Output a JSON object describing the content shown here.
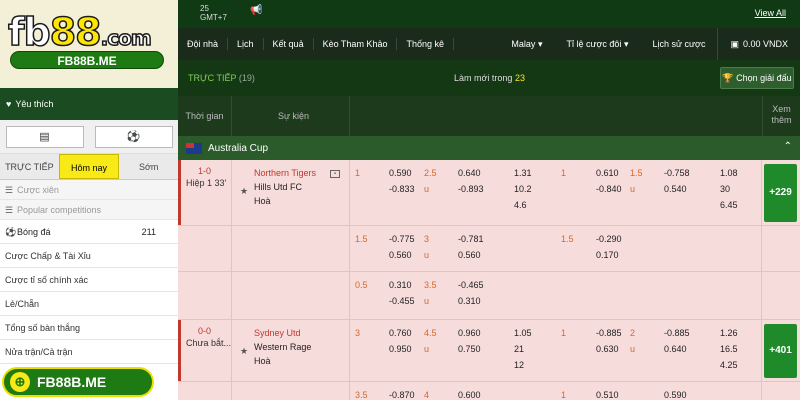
{
  "topbar": {
    "gmt_line1": "25",
    "gmt_line2": "GMT+7",
    "view_all": "View All"
  },
  "logo": {
    "brand_a": "fb",
    "brand_b": "88",
    "brand_c": ".com",
    "subtitle": "FB88B.ME"
  },
  "nav": {
    "items": [
      "Đội nhà",
      "Lịch",
      "Kết quả",
      "Kèo Tham Khảo",
      "Thống kê"
    ],
    "odds_type": "Malay",
    "odds_ratio": "Tỉ lệ cược đôi",
    "history": "Lịch sử cược",
    "balance": "0.00 VNDX"
  },
  "sidebar": {
    "favorites": "Yêu thích",
    "tabs": [
      "TRỰC TIẾP",
      "Hôm nay",
      "Sớm"
    ],
    "bet_type": "Cược xiên",
    "popular": "Popular competitions",
    "sport": "Bóng đá",
    "sport_count": "211",
    "menu": [
      "Cược Chấp & Tài Xỉu",
      "Cược tỉ số chính xác",
      "Lẻ/Chẵn",
      "Tổng số bàn thắng",
      "Nửa trận/Cả trận"
    ],
    "bottom_badge": "FB88B.ME"
  },
  "main": {
    "live_label": "TRỰC TIẾP",
    "live_count": "(19)",
    "refresh_label": "Làm mới trong",
    "refresh_value": "23",
    "pick_league": "Chọn giải đấu",
    "col_time": "Thời gian",
    "col_event": "Sự kiện",
    "col_more_1": "Xem",
    "col_more_2": "thêm",
    "league": "Australia Cup"
  },
  "matches": [
    {
      "score": "1-0",
      "status": "Hiệp 1 33'",
      "home": "Northern Tigers",
      "away": "Hills Utd FC",
      "draw": "Hoà",
      "more": "+229",
      "lines": [
        {
          "h1": "1",
          "hv1": "0.590",
          "hv2": "-0.833",
          "o1": "2.5",
          "ou": "u",
          "ov1": "0.640",
          "ov2": "-0.893",
          "x1": "1.31",
          "x2": "10.2",
          "x3": "4.6",
          "h2": "1",
          "hhv1": "0.610",
          "hhv2": "-0.840",
          "ho1": "1.5",
          "hou": "u",
          "hov1": "-0.758",
          "hov2": "0.540",
          "hx1": "1.08",
          "hx2": "30",
          "hx3": "6.45"
        },
        {
          "h1": "1.5",
          "hv1": "-0.775",
          "hv2": "0.560",
          "o1": "3",
          "ou": "u",
          "ov1": "-0.781",
          "ov2": "0.560",
          "h2": "1.5",
          "hhv1": "-0.290",
          "hhv2": "0.170"
        },
        {
          "h1": "0.5",
          "hv1": "0.310",
          "hv2": "-0.455",
          "o1": "3.5",
          "ou": "u",
          "ov1": "-0.465",
          "ov2": "0.310"
        }
      ]
    },
    {
      "score": "0-0",
      "status": "Chưa bắt...",
      "home": "Sydney Utd",
      "away": "Western Rage",
      "draw": "Hoà",
      "more": "+401",
      "lines": [
        {
          "h1": "3",
          "hv1": "0.760",
          "hv2": "0.950",
          "o1": "4.5",
          "ou": "u",
          "ov1": "0.960",
          "ov2": "0.750",
          "x1": "1.05",
          "x2": "21",
          "x3": "12",
          "h2": "1",
          "hhv1": "-0.885",
          "hhv2": "0.630",
          "ho1": "2",
          "hou": "u",
          "hov1": "-0.885",
          "hov2": "0.640",
          "hx1": "1.26",
          "hx2": "16.5",
          "hx3": "4.25"
        },
        {
          "h1": "3.5",
          "hv1": "-0.870",
          "o1": "4",
          "ov1": "0.600",
          "h2": "1",
          "hhv1": "0.510",
          "hov1": "0.590"
        }
      ]
    }
  ]
}
